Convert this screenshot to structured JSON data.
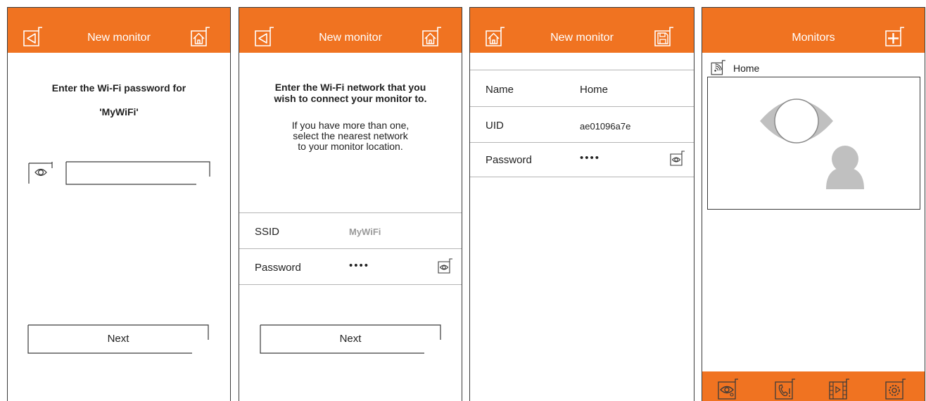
{
  "colors": {
    "accent": "#f07321",
    "divider": "#b5b5b5",
    "placeholder_gray": "#c0c0c0"
  },
  "screen1": {
    "title": "New monitor",
    "back_icon": "back-arrow-icon",
    "home_icon": "home-icon",
    "prompt_line1": "Enter the Wi-Fi password for",
    "prompt_line2": "'MyWiFi'",
    "password_value": "",
    "show_password_icon": "eye-icon",
    "next_label": "Next"
  },
  "screen2": {
    "title": "New monitor",
    "back_icon": "back-arrow-icon",
    "home_icon": "home-icon",
    "prompt_bold_1": "Enter the Wi-Fi network that you",
    "prompt_bold_2": "wish to connect your monitor to.",
    "hint_1": "If you have more than one,",
    "hint_2": "select the nearest network",
    "hint_3": "to your monitor location.",
    "ssid_label": "SSID",
    "ssid_value": "MyWiFi",
    "password_label": "Password",
    "password_value": "••••",
    "next_label": "Next"
  },
  "screen3": {
    "title": "New monitor",
    "home_icon": "home-icon",
    "save_icon": "save-icon",
    "name_label": "Name",
    "name_value": "Home",
    "uid_label": "UID",
    "uid_value": "ae01096a7e",
    "password_label": "Password",
    "password_value": "••••"
  },
  "screen4": {
    "title": "Monitors",
    "add_icon": "add-icon",
    "monitor_name": "Home",
    "wifi_icon": "wifi-signal-icon",
    "bottom_icons": [
      "monitor-view-icon",
      "call-log-icon",
      "recordings-icon",
      "settings-icon"
    ]
  }
}
